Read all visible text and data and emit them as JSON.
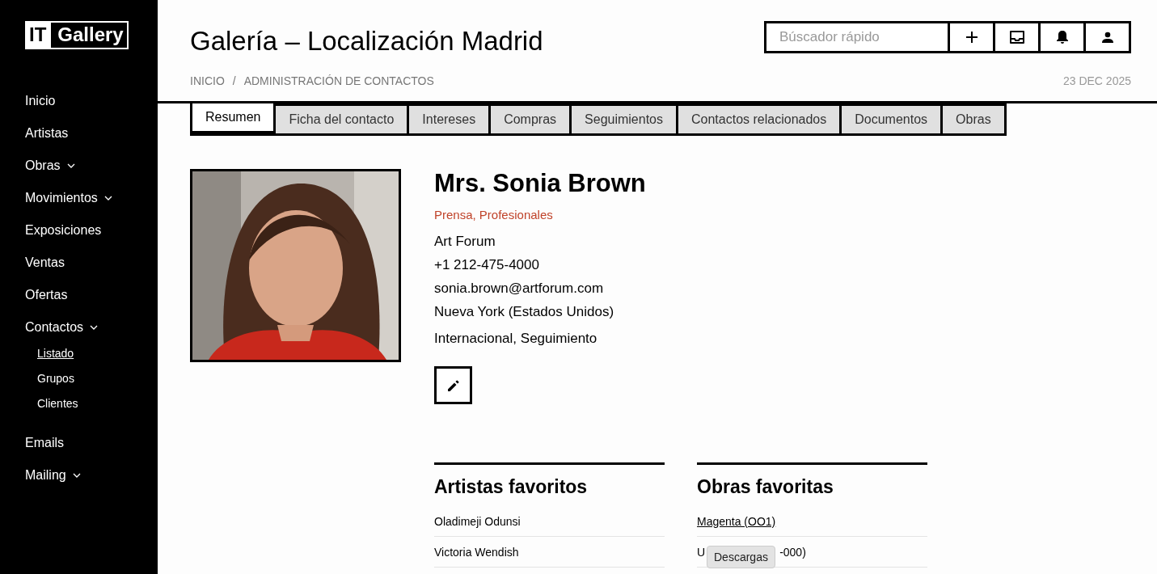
{
  "logo": {
    "left": "IT",
    "right": "Gallery"
  },
  "sidebar": {
    "items": [
      {
        "label": "Inicio",
        "submenu": false
      },
      {
        "label": "Artistas",
        "submenu": false
      },
      {
        "label": "Obras",
        "submenu": true
      },
      {
        "label": "Movimientos",
        "submenu": true
      },
      {
        "label": "Exposiciones",
        "submenu": false
      },
      {
        "label": "Ventas",
        "submenu": false
      },
      {
        "label": "Ofertas",
        "submenu": false
      },
      {
        "label": "Contactos",
        "submenu": true,
        "children": [
          {
            "label": "Listado",
            "selected": true
          },
          {
            "label": "Grupos",
            "selected": false
          },
          {
            "label": "Clientes",
            "selected": false
          }
        ]
      },
      {
        "label": "Emails",
        "submenu": false
      },
      {
        "label": "Mailing",
        "submenu": true
      }
    ]
  },
  "header": {
    "title": "Galería – Localización Madrid",
    "search": {
      "placeholder": "Búscador rápido"
    },
    "breadcrumbs": [
      "INICIO",
      "ADMINISTRACIÓN DE CONTACTOS"
    ],
    "separator": "/",
    "date": "23 DEC 2025"
  },
  "tabs": [
    {
      "label": "Resumen",
      "selected": true
    },
    {
      "label": "Ficha del contacto",
      "selected": false
    },
    {
      "label": "Intereses",
      "selected": false
    },
    {
      "label": "Compras",
      "selected": false
    },
    {
      "label": "Seguimientos",
      "selected": false
    },
    {
      "label": "Contactos relacionados",
      "selected": false
    },
    {
      "label": "Documentos",
      "selected": false
    },
    {
      "label": "Obras",
      "selected": false
    }
  ],
  "contact": {
    "name": "Mrs. Sonia Brown",
    "categories": "Prensa, Profesionales",
    "company": "Art Forum",
    "phone": "+1 212-475-4000",
    "email": "sonia.brown@artforum.com",
    "location": "Nueva York (Estados Unidos)",
    "tags": "Internacional, Seguimiento"
  },
  "favorite_artists": {
    "title": "Artistas favoritos",
    "items": [
      "Oladimeji Odunsi",
      "Victoria Wendish"
    ]
  },
  "favorite_works": {
    "title": "Obras favoritas",
    "items": [
      {
        "parts": [
          "Magenta (OO1)"
        ]
      },
      {
        "parts": [
          "U",
          "-000)"
        ]
      }
    ]
  },
  "tooltip": "Descargas"
}
